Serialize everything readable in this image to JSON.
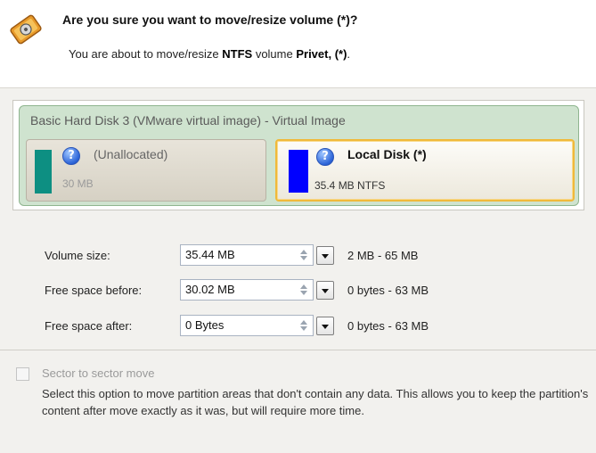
{
  "header": {
    "title": "Are you sure you want to move/resize volume (*)?",
    "sub_prefix": "You are about to move/resize ",
    "sub_fs": "NTFS",
    "sub_mid": " volume ",
    "sub_volume": "Privet, (*)",
    "sub_suffix": ".",
    "icon": "disk-resize-icon"
  },
  "disk": {
    "title": "Basic Hard Disk 3 (VMware virtual image) - Virtual Image",
    "panel_color": "#cfe3cf",
    "partitions": [
      {
        "name": "(Unallocated)",
        "size": "30 MB",
        "color": "#0d8f82",
        "selected": false
      },
      {
        "name": "Local Disk (*)",
        "size": "35.4 MB NTFS",
        "color": "#0000ff",
        "selected": true
      }
    ],
    "selection_color": "#f0b93a"
  },
  "fields": [
    {
      "label": "Volume size:",
      "value": "35.44 MB",
      "range": "2 MB - 65 MB"
    },
    {
      "label": "Free space before:",
      "value": "30.02 MB",
      "range": "0 bytes - 63 MB"
    },
    {
      "label": "Free space after:",
      "value": "0 Bytes",
      "range": "0 bytes - 63 MB"
    }
  ],
  "sector_move": {
    "label": "Sector to sector move",
    "checked": false,
    "enabled": false,
    "description": "Select this option to move partition areas that don't contain any data. This allows you to keep the partition's content after move exactly as it was, but will require more time."
  }
}
